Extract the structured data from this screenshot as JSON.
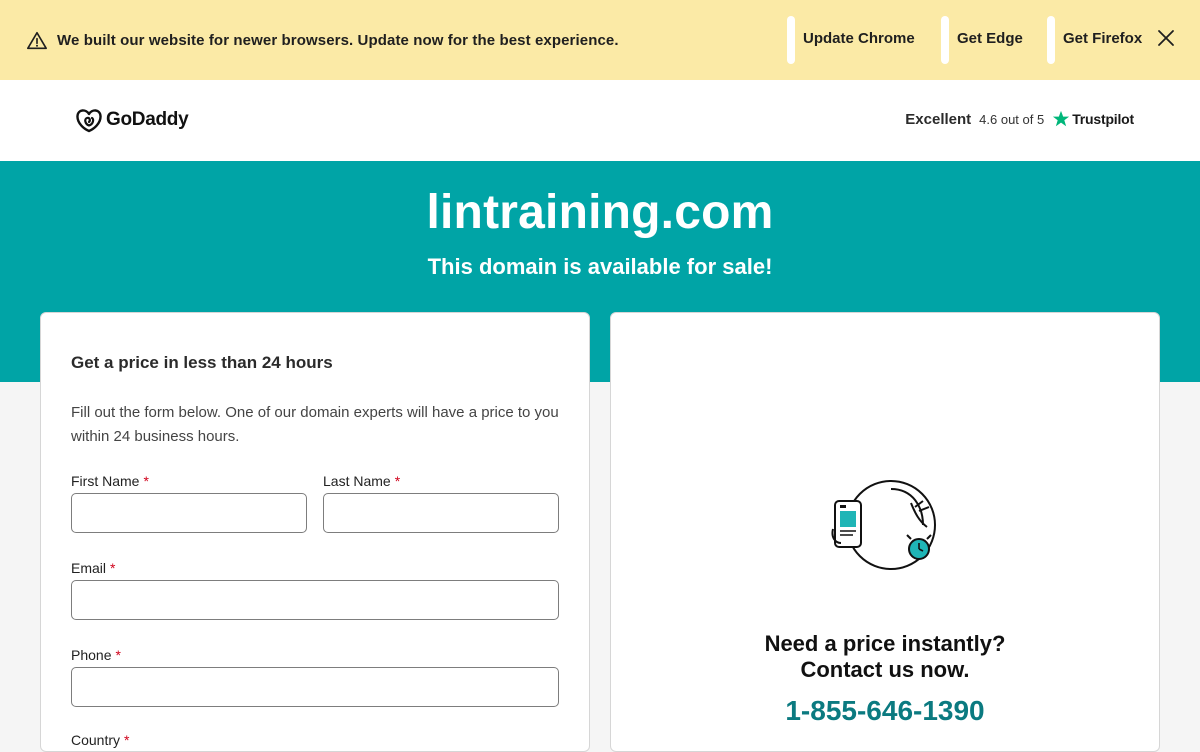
{
  "notice": {
    "text": "We built our website for newer browsers. Update now for the best experience.",
    "links": [
      "Update Chrome",
      "Get Edge",
      "Get Firefox"
    ],
    "icons": {
      "warning": "warning-triangle-icon",
      "close": "close-icon"
    }
  },
  "header": {
    "logo_text": "GoDaddy",
    "rating_label": "Excellent",
    "rating_score": "4.6 out of 5",
    "rating_brand": "Trustpilot"
  },
  "hero": {
    "domain": "lintraining.com",
    "subtitle": "This domain is available for sale!"
  },
  "form": {
    "title": "Get a price in less than 24 hours",
    "description": "Fill out the form below. One of our domain experts will have a price to you within 24 business hours.",
    "first_name_label": "First Name",
    "last_name_label": "Last Name",
    "email_label": "Email",
    "phone_label": "Phone",
    "country_label": "Country",
    "required_marker": "*"
  },
  "contact": {
    "line1": "Need a price instantly?",
    "line2": "Contact us now.",
    "phone": "1-855-646-1390"
  },
  "colors": {
    "banner_bg": "#fbeaa6",
    "hero_bg": "#00a4a6",
    "phone_color": "#0b7a80",
    "required_color": "#d0021b",
    "trustpilot_green": "#00b67a"
  }
}
